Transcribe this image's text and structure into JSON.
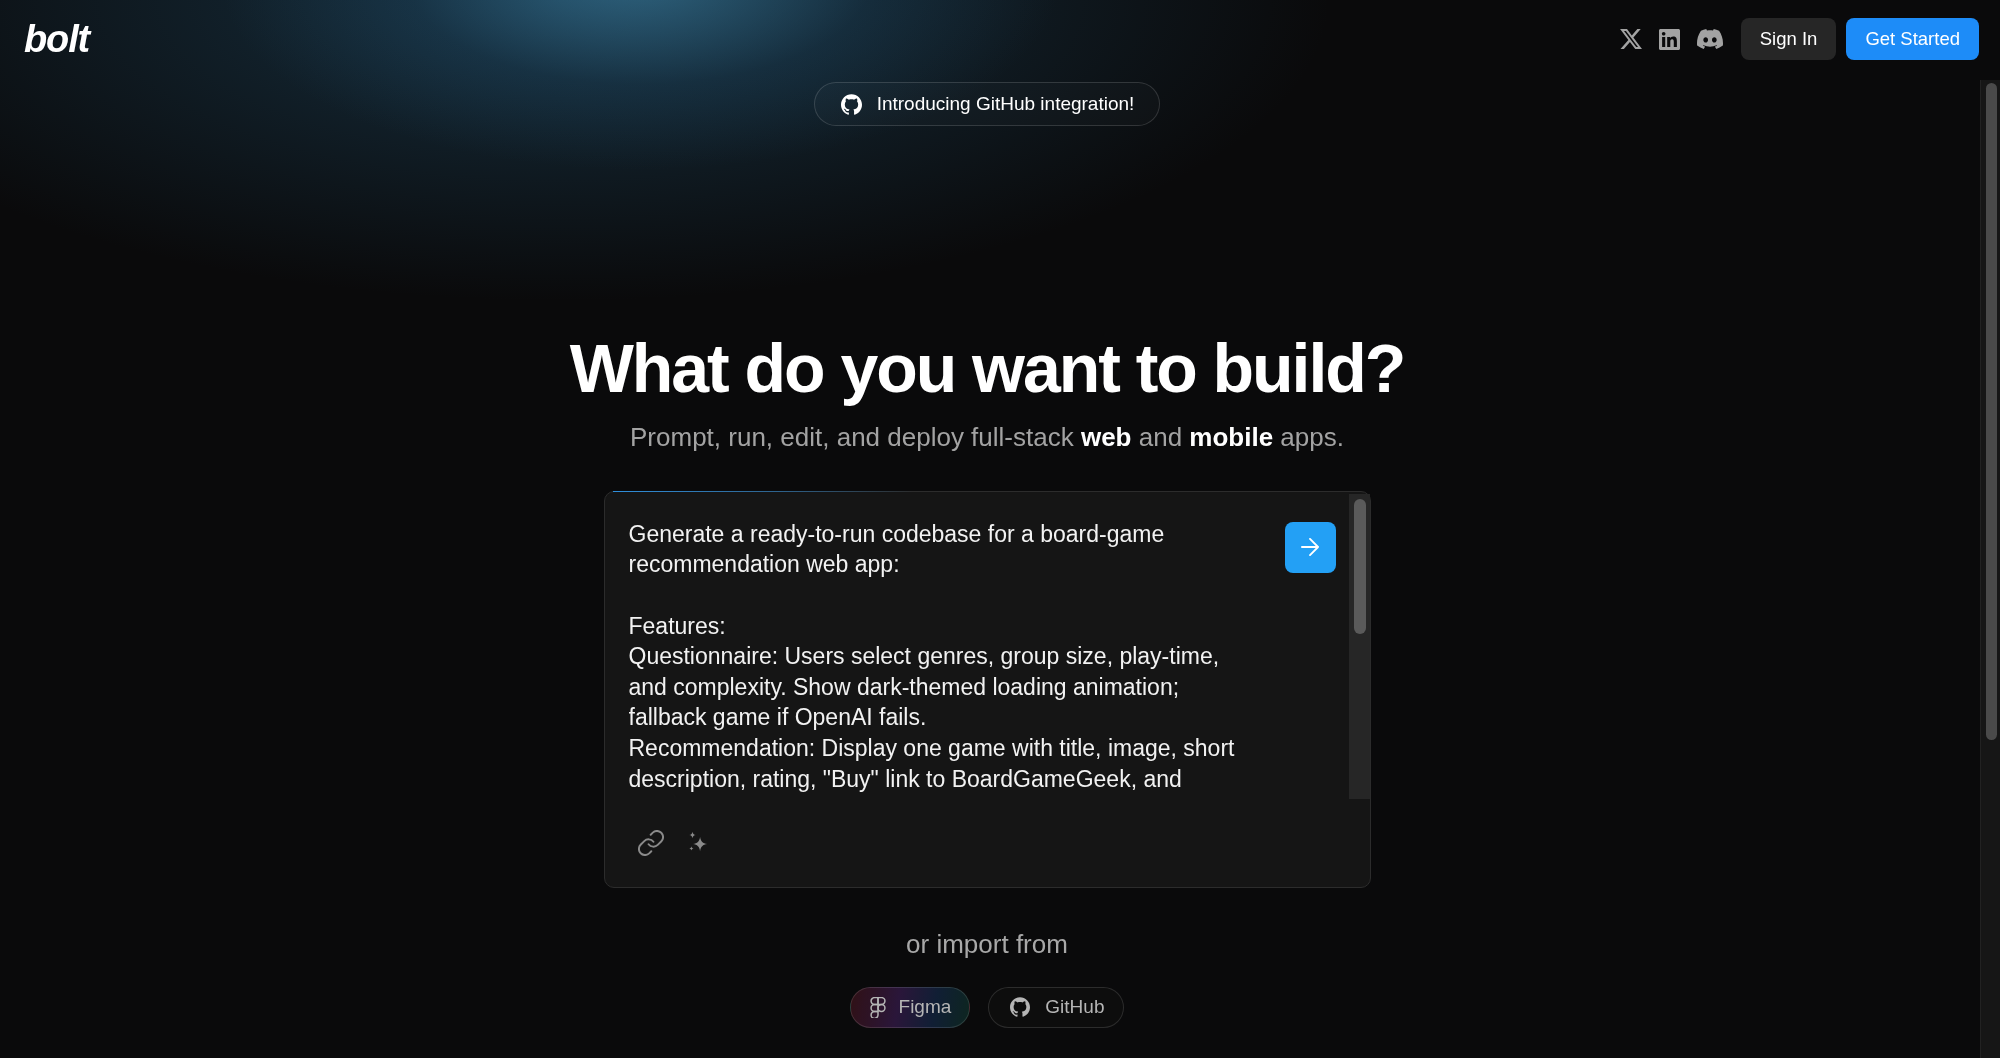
{
  "header": {
    "logo": "bolt",
    "buttons": [
      {
        "label": "Sign In",
        "kind": "secondary"
      },
      {
        "label": "Get Started",
        "kind": "primary"
      }
    ]
  },
  "announcement": {
    "text": "Introducing GitHub integration!"
  },
  "hero": {
    "title": "What do you want to build?",
    "subtitle": "Prompt, run, edit, and deploy full-stack **web** and **mobile** apps."
  },
  "prompt": {
    "value": "Generate a ready-to-run codebase for a board-game recommendation web app:\n\nFeatures:\nQuestionnaire: Users select genres, group size, play-time, and complexity. Show dark-themed loading animation; fallback game if OpenAI fails.\nRecommendation: Display one game with title, image, short description, rating, \"Buy\" link to BoardGameGeek, and"
  },
  "import": {
    "label": "or import from",
    "sources": [
      {
        "label": "Figma",
        "kind": "figma"
      },
      {
        "label": "GitHub",
        "kind": "github"
      }
    ]
  }
}
